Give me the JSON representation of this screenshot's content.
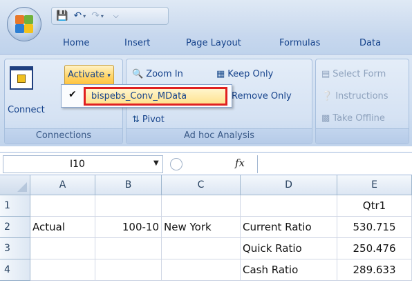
{
  "ribbon_tabs": [
    "Home",
    "Insert",
    "Page Layout",
    "Formulas",
    "Data"
  ],
  "groups": {
    "connections": {
      "label": "Connections",
      "connect_label": "Connect",
      "activate_label": "Activate",
      "dropdown_item": "bispebs_Conv_MData"
    },
    "adhoc": {
      "label": "Ad hoc Analysis",
      "zoom_in": "Zoom In",
      "keep_only": "Keep Only",
      "remove_only": "Remove Only",
      "pivot": "Pivot"
    },
    "offline": {
      "select_form": "Select Form",
      "instructions": "Instructions",
      "take_offline": "Take Offline"
    }
  },
  "formula_bar": {
    "name_box": "I10",
    "fx": "fx",
    "value": ""
  },
  "grid": {
    "columns": [
      "A",
      "B",
      "C",
      "D",
      "E"
    ],
    "rows": [
      {
        "num": "1",
        "cells": [
          "",
          "",
          "",
          "",
          "Qtr1"
        ]
      },
      {
        "num": "2",
        "cells": [
          "Actual",
          "100-10",
          "New York",
          "Current Ratio",
          "530.715"
        ]
      },
      {
        "num": "3",
        "cells": [
          "",
          "",
          "",
          "Quick Ratio",
          "250.476"
        ]
      },
      {
        "num": "4",
        "cells": [
          "",
          "",
          "",
          "Cash Ratio",
          "289.633"
        ]
      }
    ]
  },
  "colors": {
    "ribbon_text": "#15428b",
    "activate_highlight": "#ffd870",
    "dropdown_outline": "#e02020"
  },
  "icons": {
    "office_button": "office-logo",
    "qat": [
      "save-icon",
      "undo-icon",
      "redo-icon",
      "customize-arrow-icon"
    ]
  }
}
